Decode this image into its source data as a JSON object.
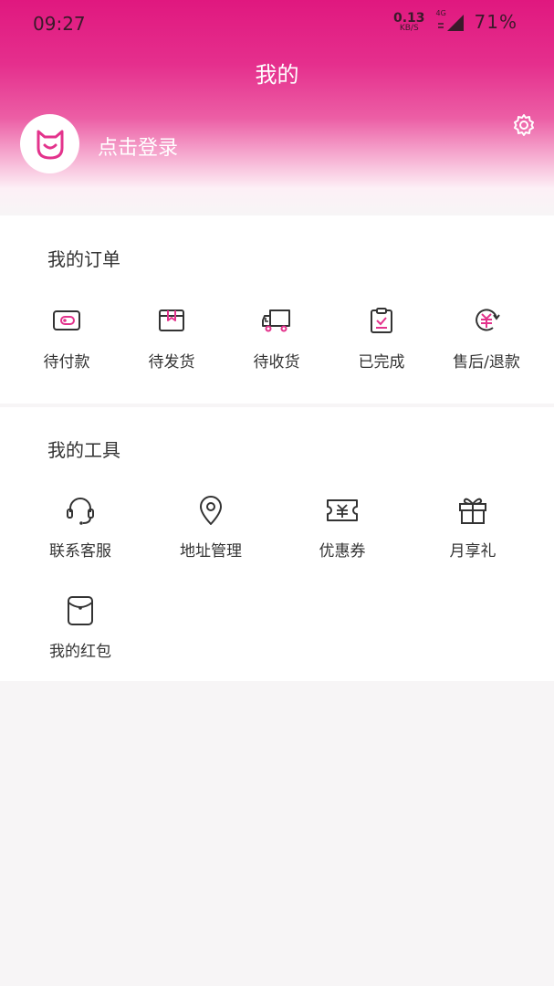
{
  "status_bar": {
    "time": "09:27",
    "net_speed_value": "0.13",
    "net_speed_unit": "KB/S",
    "network_type": "4G",
    "battery": "71%"
  },
  "header": {
    "title": "我的",
    "login_text": "点击登录"
  },
  "orders": {
    "title": "我的订单",
    "items": [
      {
        "label": "待付款",
        "icon": "wallet-icon"
      },
      {
        "label": "待发货",
        "icon": "box-icon"
      },
      {
        "label": "待收货",
        "icon": "truck-icon"
      },
      {
        "label": "已完成",
        "icon": "clipboard-check-icon"
      },
      {
        "label": "售后/退款",
        "icon": "refund-icon"
      }
    ]
  },
  "tools": {
    "title": "我的工具",
    "items": [
      {
        "label": "联系客服",
        "icon": "headset-icon"
      },
      {
        "label": "地址管理",
        "icon": "location-pin-icon"
      },
      {
        "label": "优惠券",
        "icon": "coupon-icon"
      },
      {
        "label": "月享礼",
        "icon": "gift-icon"
      },
      {
        "label": "我的红包",
        "icon": "red-packet-icon"
      }
    ]
  },
  "colors": {
    "brand": "#e0187f",
    "accent": "#e3338c",
    "icon_stroke": "#333333"
  }
}
